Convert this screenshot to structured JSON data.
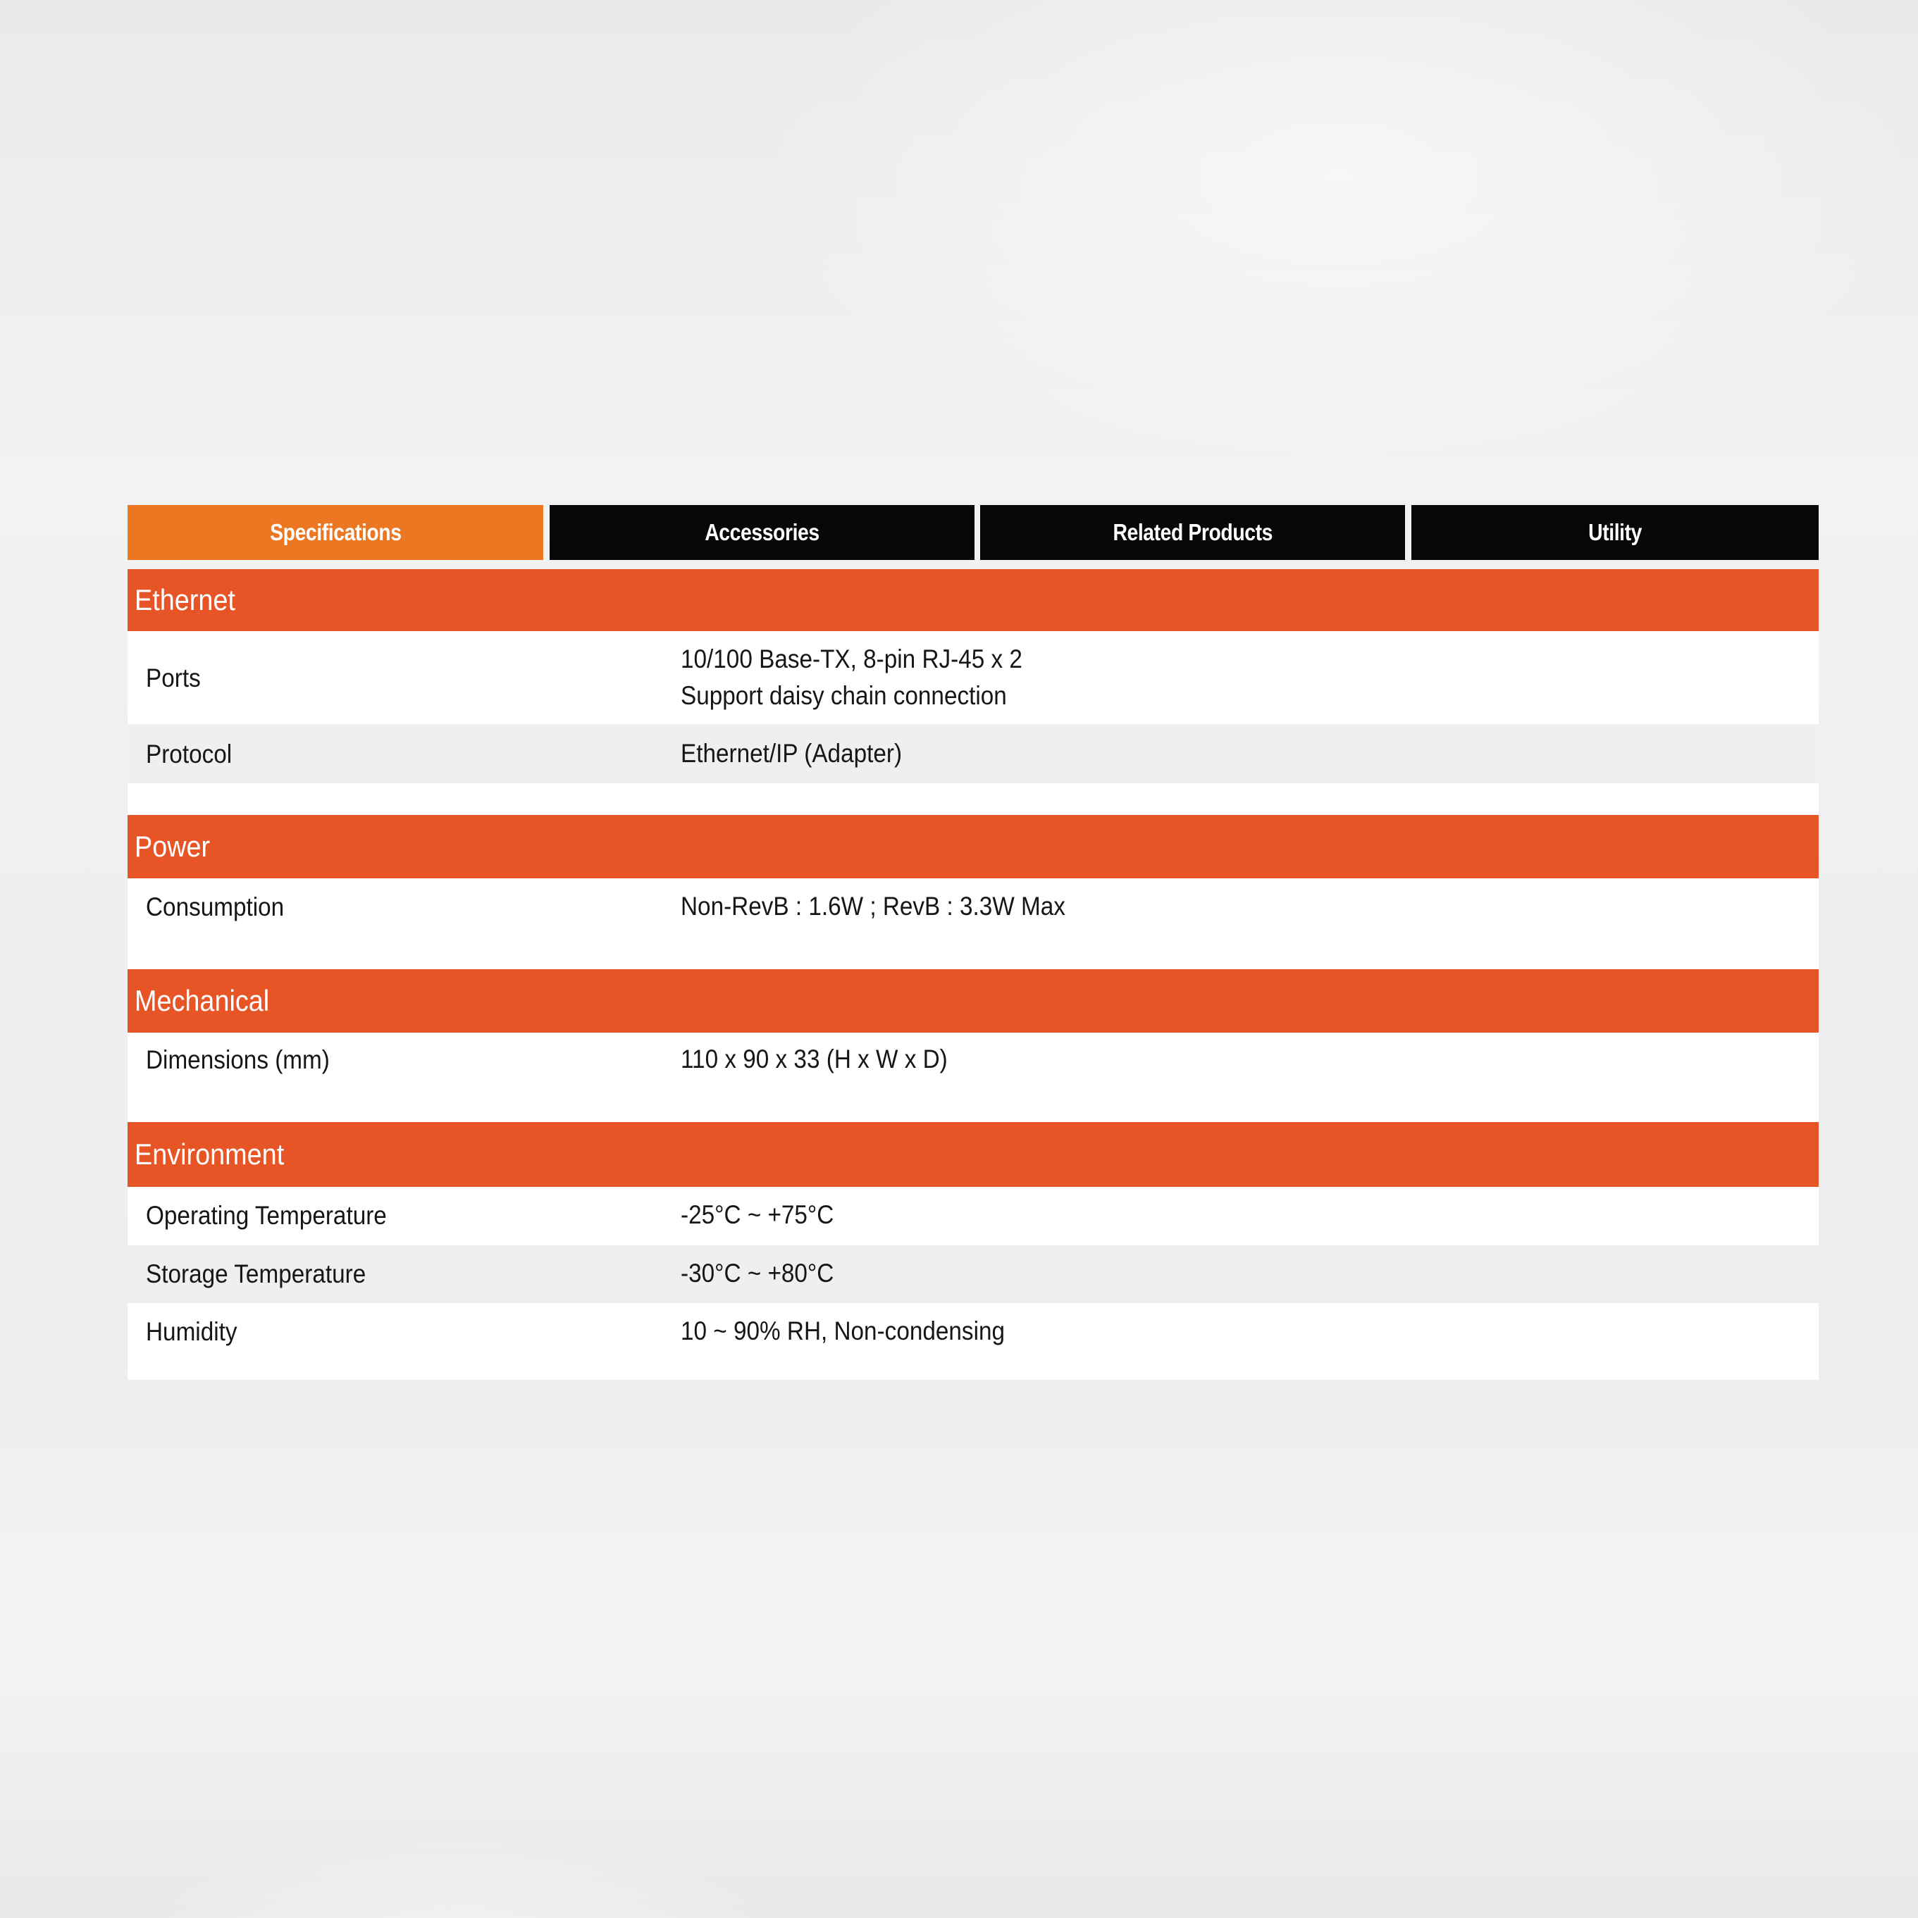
{
  "tabs": [
    {
      "label": "Specifications",
      "active": true
    },
    {
      "label": "Accessories",
      "active": false
    },
    {
      "label": "Related Products",
      "active": false
    },
    {
      "label": "Utility",
      "active": false
    }
  ],
  "colors": {
    "active_tab": "#ec7723",
    "inactive_tab": "#050708",
    "section_header": "#e75527",
    "alt_row": "#eeeff0"
  },
  "sections": [
    {
      "title": "Ethernet",
      "rows": [
        {
          "label": "Ports",
          "value": [
            "10/100 Base-TX, 8-pin RJ-45 x 2",
            "Support daisy chain connection"
          ]
        },
        {
          "label": "Protocol",
          "value": [
            "Ethernet/IP (Adapter)"
          ]
        }
      ]
    },
    {
      "title": "Power",
      "rows": [
        {
          "label": "Consumption",
          "value": [
            "Non-RevB : 1.6W ; RevB : 3.3W Max"
          ]
        }
      ]
    },
    {
      "title": "Mechanical",
      "rows": [
        {
          "label": "Dimensions (mm)",
          "value": [
            "110 x 90 x 33 (H x W x D)"
          ]
        }
      ]
    },
    {
      "title": "Environment",
      "rows": [
        {
          "label": "Operating Temperature",
          "value": [
            "-25°C ~ +75°C"
          ]
        },
        {
          "label": "Storage Temperature",
          "value": [
            "-30°C ~ +80°C"
          ]
        },
        {
          "label": "Humidity",
          "value": [
            "10 ~ 90% RH, Non-condensing"
          ]
        }
      ]
    }
  ]
}
